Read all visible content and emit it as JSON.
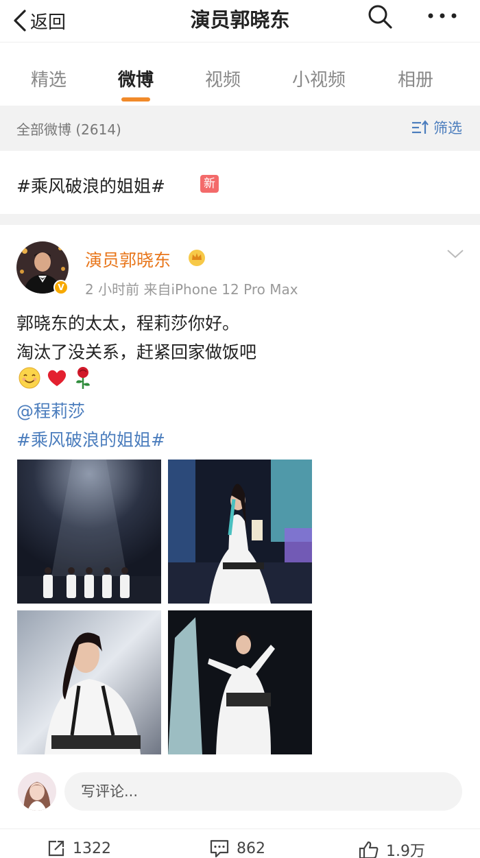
{
  "nav": {
    "back_label": "返回",
    "title": "演员郭晓东",
    "search_icon": "search-icon",
    "more_icon": "more-icon"
  },
  "tabs": [
    {
      "label": "精选",
      "active": false
    },
    {
      "label": "微博",
      "active": true
    },
    {
      "label": "视频",
      "active": false
    },
    {
      "label": "小视频",
      "active": false
    },
    {
      "label": "相册",
      "active": false
    }
  ],
  "filterbar": {
    "count_label": "全部微博 (2614)",
    "filter_label": "筛选"
  },
  "topic": {
    "text": "#乘风破浪的姐姐#",
    "badge": "新"
  },
  "post": {
    "author": "演员郭晓东",
    "meta": "2 小时前  来自iPhone 12 Pro Max",
    "lines": [
      "郭晓东的太太，程莉莎你好。",
      "淘汰了没关系，赶紧回家做饭吧"
    ],
    "emojis": [
      "smile-emoji",
      "heart-emoji",
      "rose-emoji"
    ],
    "mention": "@程莉莎",
    "hashtag": "#乘风破浪的姐姐#",
    "photos": [
      "stage-group-photo",
      "dance-pose-photo",
      "portrait-photo",
      "pointing-pose-photo"
    ]
  },
  "comment": {
    "placeholder": "写评论..."
  },
  "actions": {
    "repost": "1322",
    "comments": "862",
    "likes": "1.9万"
  },
  "colors": {
    "accent_orange": "#f18a2a",
    "link_blue": "#4b7dbd",
    "author_orange": "#e8761b",
    "new_badge_red": "#f36a6a"
  }
}
